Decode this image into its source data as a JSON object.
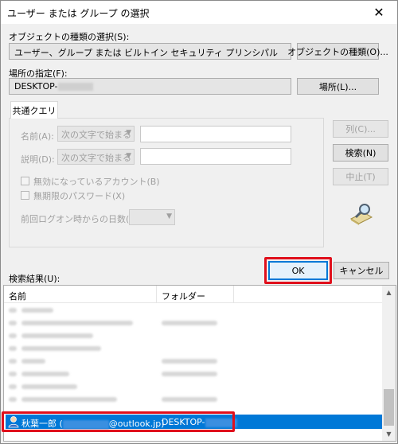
{
  "window": {
    "title": "ユーザー または グループ の選択",
    "close_glyph": "✕"
  },
  "object_types": {
    "label": "オブジェクトの種類の選択(S):",
    "value": "ユーザー、グループ または ビルトイン セキュリティ プリンシパル",
    "button": "オブジェクトの種類(O)..."
  },
  "location": {
    "label": "場所の指定(F):",
    "value": "DESKTOP-",
    "button": "場所(L)..."
  },
  "query": {
    "tab": "共通クエリ",
    "name_label": "名前(A):",
    "name_mode": "次の文字で始まる",
    "desc_label": "説明(D):",
    "desc_mode": "次の文字で始まる",
    "disabled_accounts": "無効になっているアカウント(B)",
    "no_expire_password": "無期限のパスワード(X)",
    "days_since_logon": "前回ログオン時からの日数(I):"
  },
  "side_buttons": {
    "columns": "列(C)...",
    "search": "検索(N)",
    "stop": "中止(T)"
  },
  "dialog_buttons": {
    "ok": "OK",
    "cancel": "キャンセル"
  },
  "results": {
    "label": "検索結果(U):",
    "columns": [
      "名前",
      "フォルダー"
    ],
    "selected": {
      "name_prefix": "秋葉一郎 (",
      "name_suffix": "@outlook.jp)",
      "folder": "DESKTOP-"
    }
  },
  "colors": {
    "highlight": "#e0101c",
    "selection": "#0078d7",
    "accent": "#0078d7"
  },
  "icons": {
    "search_hint": "magnifier-icon",
    "user": "user-icon"
  }
}
